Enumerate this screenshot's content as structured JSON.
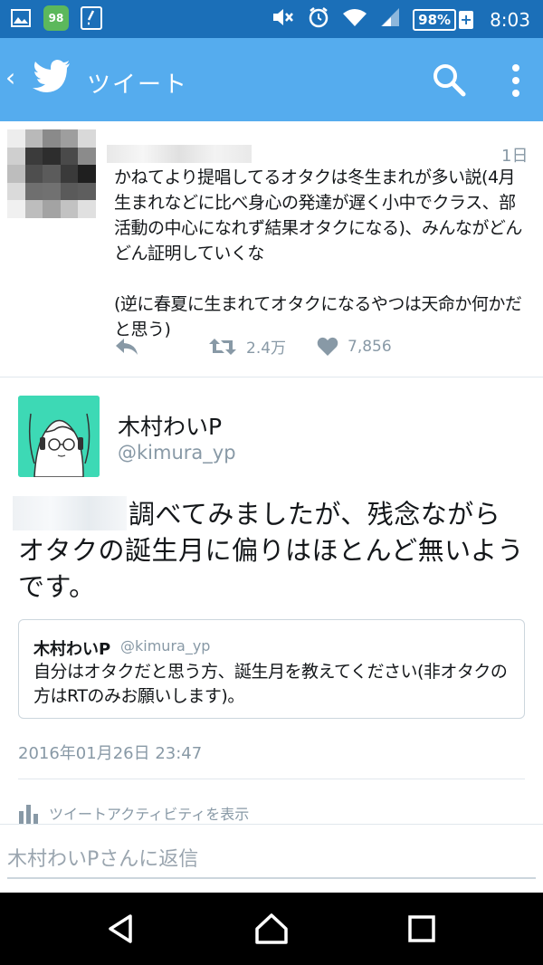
{
  "status_bar": {
    "notification_badge": "98",
    "battery": "98%",
    "battery_plus": "+",
    "time": "8:03",
    "icons": [
      "image-icon",
      "frog-app-icon",
      "edit-icon",
      "mute-icon",
      "alarm-icon",
      "wifi-icon",
      "signal-icon",
      "battery-icon"
    ]
  },
  "app_bar": {
    "back_glyph": "‹",
    "title": "ツイート",
    "icons": [
      "twitter-bird-icon",
      "search-icon",
      "more-vert-icon"
    ]
  },
  "prior_tweet": {
    "time": "1日",
    "text": "かねてより提唱してるオタクは冬生まれが多い説(4月生まれなどに比べ身心の発達が遅く小中でクラス、部活動の中心になれず結果オタクになる)、みんながどんどん証明していくな\n\n(逆に春夏に生まれてオタクになるやつは天命か何かだと思う)",
    "retweet_count": "2.4万",
    "like_count": "7,856"
  },
  "main_tweet": {
    "author_name": "木村わいP",
    "author_handle": "@kimura_yp",
    "text": "調べてみましたが、残念ながらオタクの誕生月に偏りはほとんど無いようです。",
    "quoted": {
      "author_name": "木村わいP",
      "author_handle": "@kimura_yp",
      "text": "自分はオタクだと思う方、誕生月を教えてください(非オタクの方はRTのみお願いします)。"
    },
    "timestamp": "2016年01月26日 23:47",
    "activity_label": "ツイートアクティビティを表示"
  },
  "reply": {
    "placeholder": "木村わいPさんに返信"
  },
  "colors": {
    "status_bar": "#1b6fb8",
    "app_bar": "#55acee",
    "text": "#14171a",
    "muted": "#8899a6",
    "avatar_bg": "#3dd9b5"
  }
}
